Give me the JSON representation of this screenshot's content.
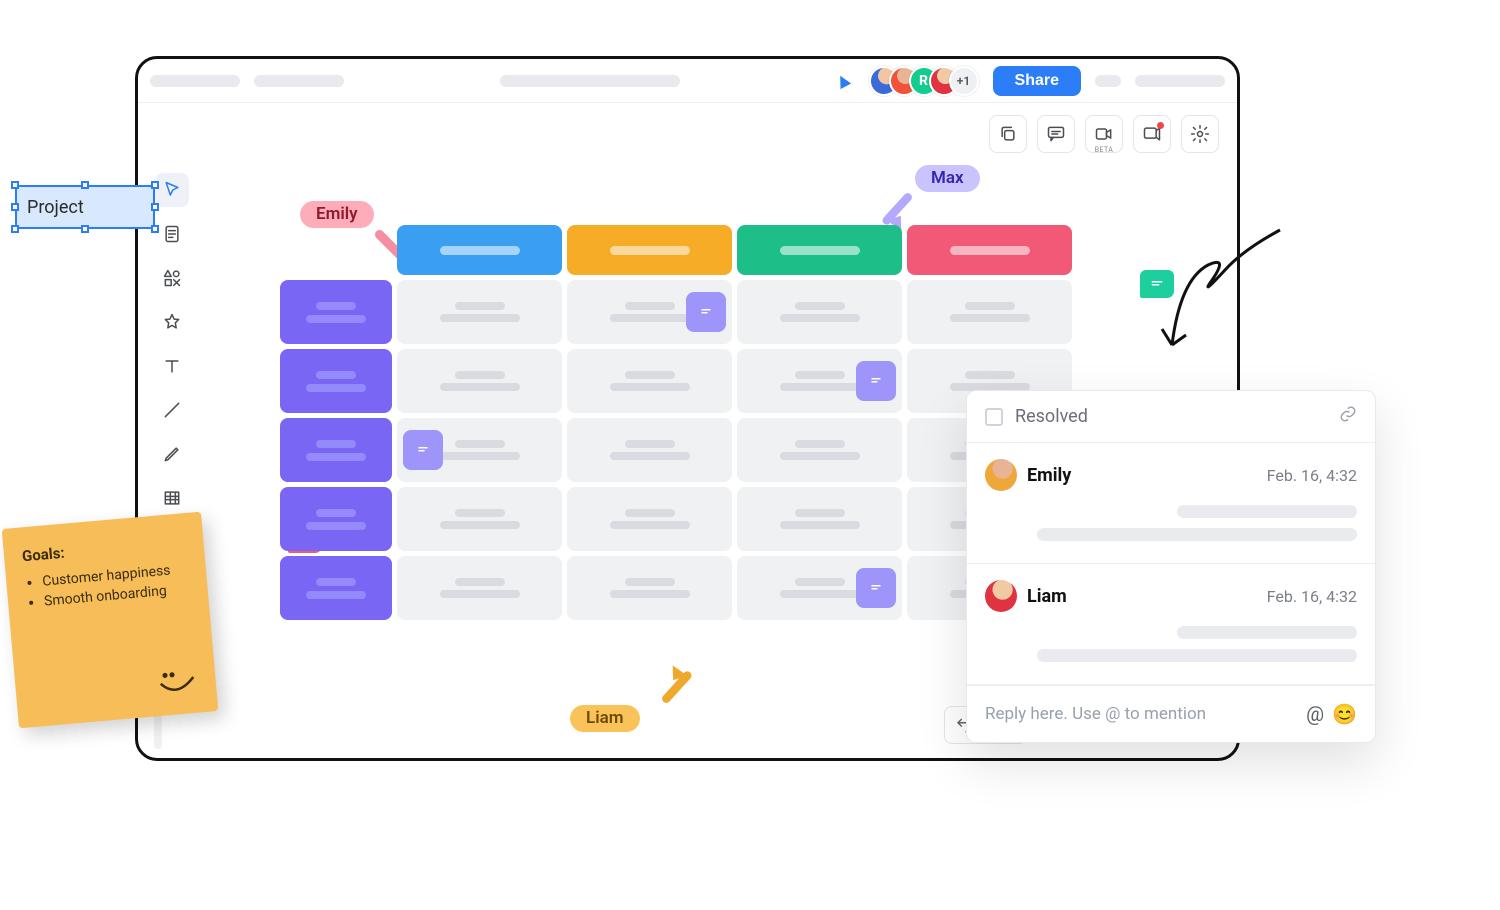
{
  "header": {
    "share_label": "Share",
    "overflow_count": "+1",
    "avatar_initial": "R"
  },
  "toolbar_icons": [
    "copy",
    "comment",
    "video",
    "present",
    "settings"
  ],
  "project_element": {
    "label": "Project"
  },
  "cursors": {
    "emily": "Emily",
    "max": "Max",
    "liam": "Liam"
  },
  "sticky": {
    "title": "Goals:",
    "items": [
      "Customer happiness",
      "Smooth onboarding"
    ]
  },
  "comments_panel": {
    "header_label": "Resolved",
    "reply_placeholder": "Reply here. Use @ to mention",
    "threads": [
      {
        "name": "Emily",
        "timestamp": "Feb. 16, 4:32"
      },
      {
        "name": "Liam",
        "timestamp": "Feb. 16, 4:32"
      }
    ]
  },
  "table": {
    "columns": [
      "blue",
      "orange",
      "green",
      "red"
    ],
    "rows": 5,
    "notes": [
      {
        "row": 0,
        "col": 1,
        "align": "right"
      },
      {
        "row": 1,
        "col": 2,
        "align": "right"
      },
      {
        "row": 2,
        "col": 0,
        "align": "left"
      },
      {
        "row": 4,
        "col": 2,
        "align": "right"
      }
    ]
  }
}
